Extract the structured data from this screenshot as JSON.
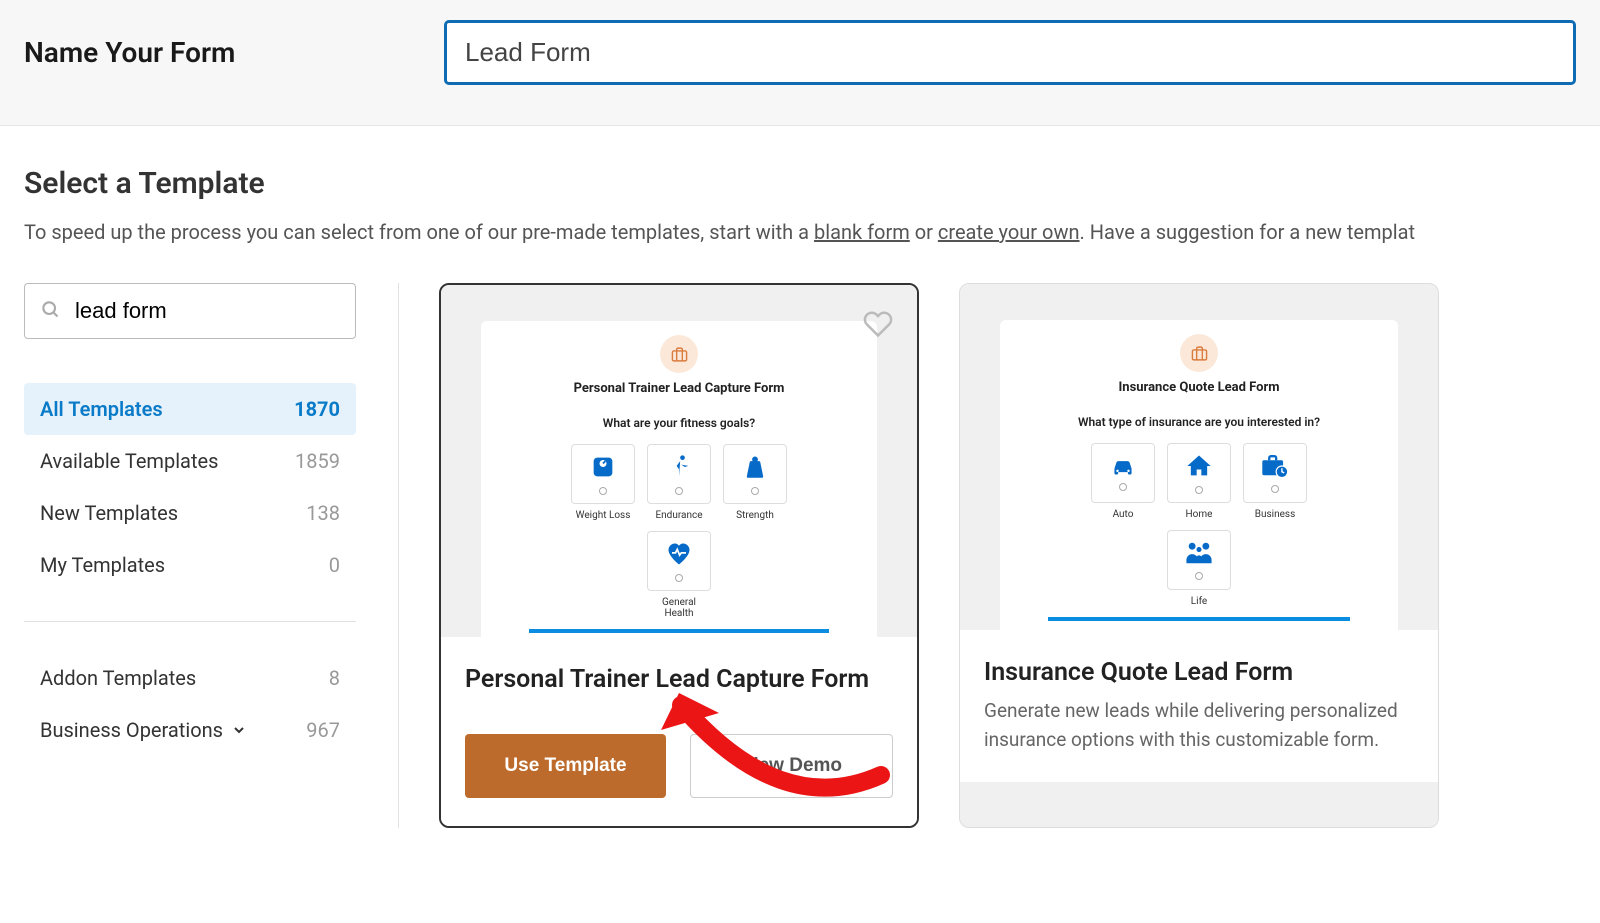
{
  "header": {
    "name_label": "Name Your Form",
    "name_input_value": "Lead Form"
  },
  "section": {
    "title": "Select a Template",
    "desc_prefix": "To speed up the process you can select from one of our pre-made templates, start with a ",
    "link_blank": "blank form",
    "desc_or": " or ",
    "link_create": "create your own",
    "desc_suffix": ". Have a suggestion for a new templat"
  },
  "search": {
    "value": "lead form"
  },
  "categories": {
    "all": {
      "label": "All Templates",
      "count": "1870"
    },
    "available": {
      "label": "Available Templates",
      "count": "1859"
    },
    "new": {
      "label": "New Templates",
      "count": "138"
    },
    "my": {
      "label": "My Templates",
      "count": "0"
    },
    "addon": {
      "label": "Addon Templates",
      "count": "8"
    },
    "business": {
      "label": "Business Operations",
      "count": "967"
    }
  },
  "templates": {
    "0": {
      "preview_title": "Personal Trainer Lead Capture Form",
      "preview_question": "What are your fitness goals?",
      "choices": {
        "0": "Weight Loss",
        "1": "Endurance",
        "2": "Strength",
        "3": "General Health"
      },
      "name": "Personal Trainer Lead Capture Form",
      "use_template": "Use Template",
      "view_demo": "View Demo"
    },
    "1": {
      "preview_title": "Insurance Quote Lead Form",
      "preview_question": "What type of insurance are you interested in?",
      "choices": {
        "0": "Auto",
        "1": "Home",
        "2": "Business",
        "3": "Life"
      },
      "name": "Insurance Quote Lead Form",
      "description": "Generate new leads while delivering personalized insurance options with this customizable form."
    }
  }
}
